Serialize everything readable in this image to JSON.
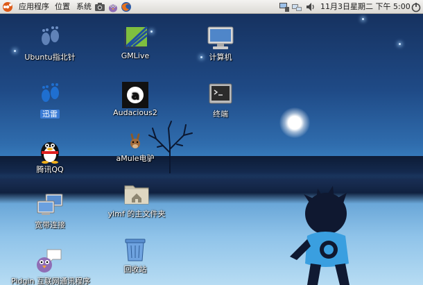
{
  "panel": {
    "menus": [
      "应用程序",
      "位置",
      "系统"
    ],
    "datetime": "11月3日星期二 下午 5:00",
    "icons": [
      "camera-icon",
      "pidgin-icon",
      "firefox-icon",
      "computer-icon",
      "network-icon",
      "volume-icon",
      "power-icon"
    ]
  },
  "desktop": {
    "icons": [
      {
        "id": "ubuntu-compass",
        "label": "Ubuntu指北针",
        "icon": "footprints-icon"
      },
      {
        "id": "gmlive",
        "label": "GMLive",
        "icon": "gmlive-icon"
      },
      {
        "id": "computer",
        "label": "计算机",
        "icon": "monitor-icon"
      },
      {
        "id": "xunlei",
        "label": "迅雷",
        "icon": "footprints-icon"
      },
      {
        "id": "audacious",
        "label": "Audacious2",
        "icon": "audacious-icon"
      },
      {
        "id": "terminal",
        "label": "终端",
        "icon": "terminal-icon"
      },
      {
        "id": "qq",
        "label": "腾讯QQ",
        "icon": "penguin-icon"
      },
      {
        "id": "amule",
        "label": "aMule电驴",
        "icon": "donkey-icon"
      },
      {
        "id": "broadband",
        "label": "宽带连接",
        "icon": "network-icon"
      },
      {
        "id": "home",
        "label": "ylmf 的主文件夹",
        "icon": "home-folder-icon"
      },
      {
        "id": "pidgin",
        "label": "Pidgin 互联网通讯程序",
        "icon": "pidgin-icon"
      },
      {
        "id": "trash",
        "label": "回收站",
        "icon": "trash-icon"
      }
    ]
  }
}
